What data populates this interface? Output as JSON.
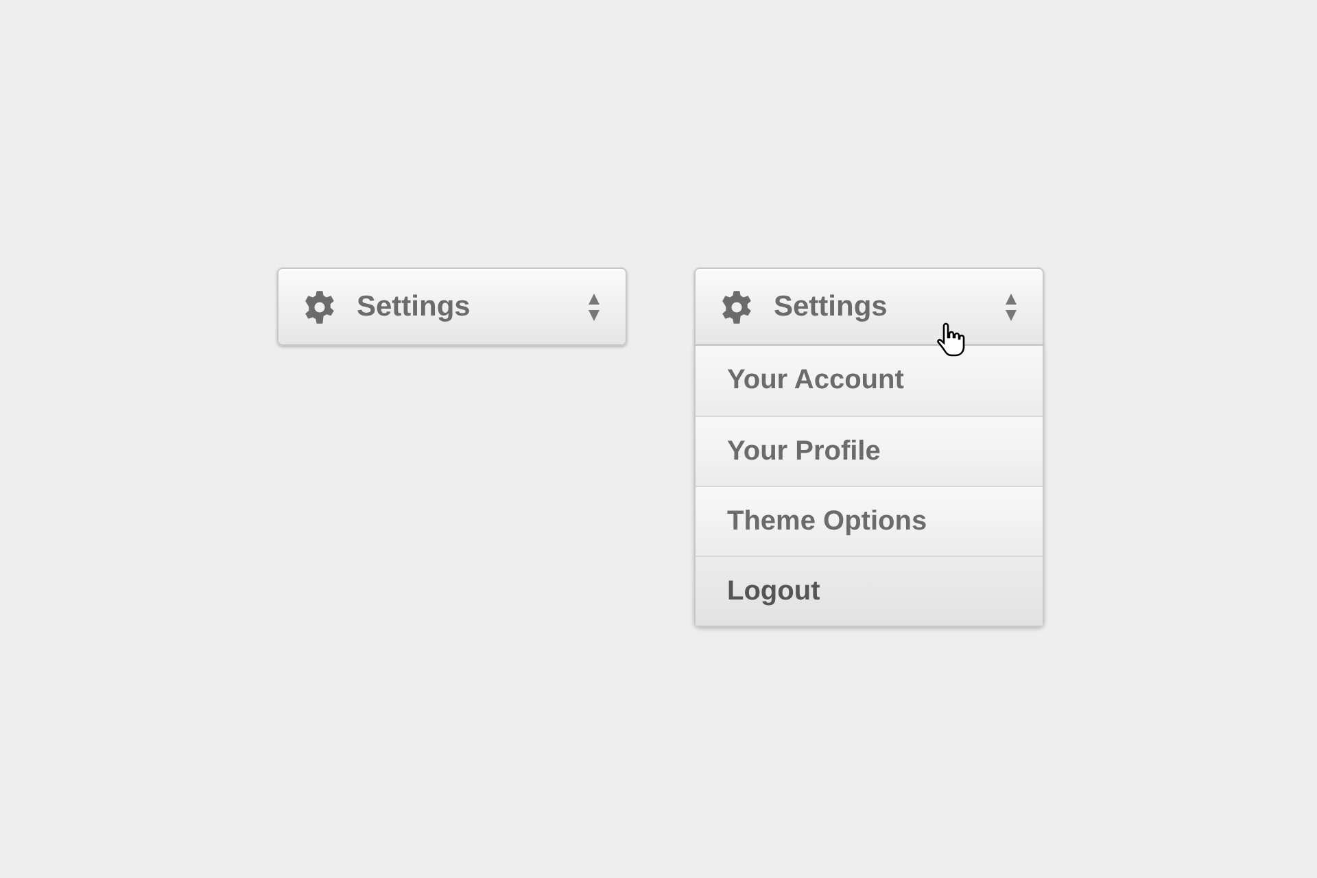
{
  "dropdowns": [
    {
      "label": "Settings",
      "expanded": false
    },
    {
      "label": "Settings",
      "expanded": true,
      "hovered": true,
      "items": [
        "Your Account",
        "Your Profile",
        "Theme Options",
        "Logout"
      ]
    }
  ]
}
